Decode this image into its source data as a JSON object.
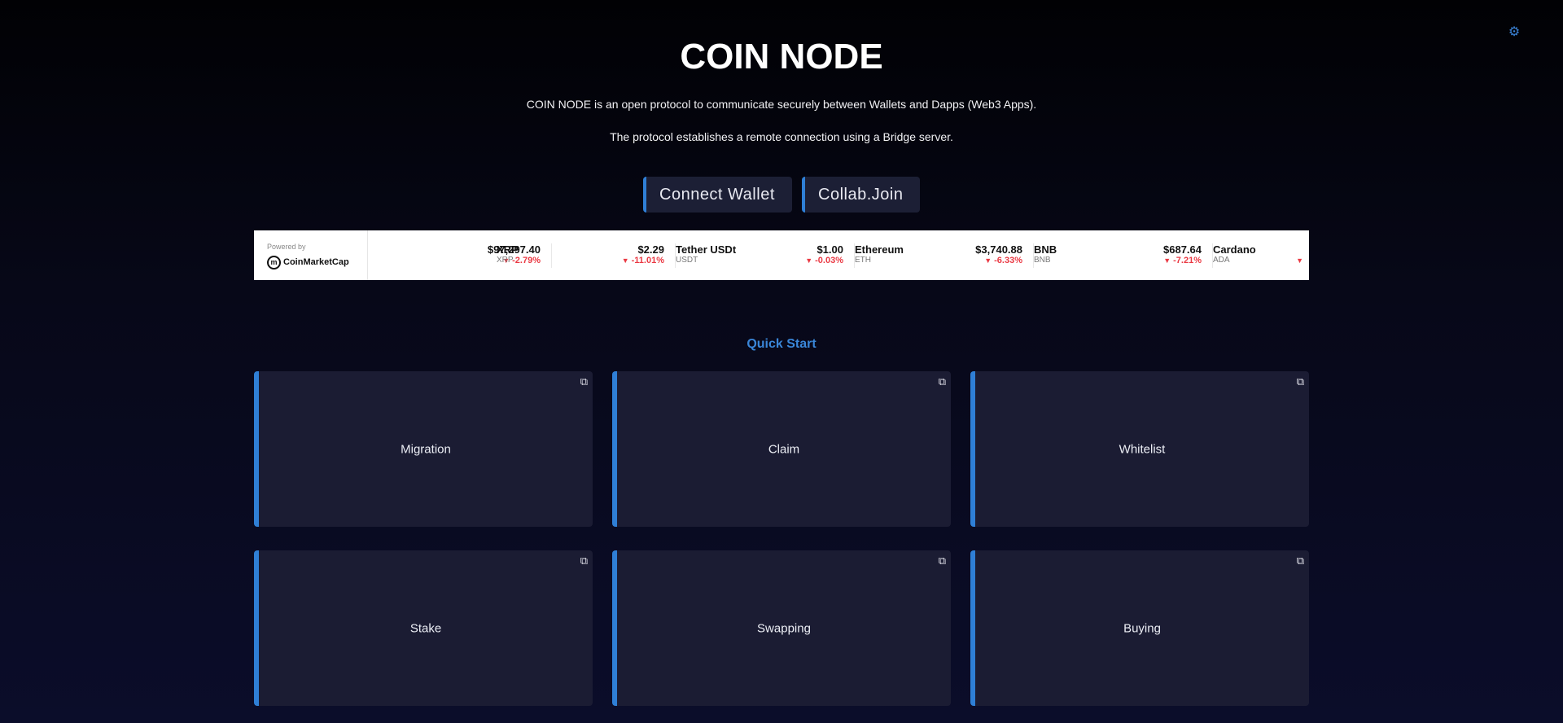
{
  "header": {
    "title": "COIN NODE",
    "description_line1": "COIN NODE is an open protocol to communicate securely between Wallets and Dapps (Web3 Apps).",
    "description_line2": "The protocol establishes a remote connection using a Bridge server.",
    "settings_icon": "gear-icon"
  },
  "actions": {
    "connect_wallet": "Connect Wallet",
    "collab_join": "Collab.Join"
  },
  "ticker": {
    "powered_by": "Powered by",
    "provider": "CoinMarketCap",
    "coins": [
      {
        "name": "",
        "symbol": "",
        "price": "$97,297.40",
        "change": "-2.79%"
      },
      {
        "name": "XRP",
        "symbol": "XRP",
        "price": "$2.29",
        "change": "-11.01%"
      },
      {
        "name": "Tether USDt",
        "symbol": "USDT",
        "price": "$1.00",
        "change": "-0.03%"
      },
      {
        "name": "Ethereum",
        "symbol": "ETH",
        "price": "$3,740.88",
        "change": "-6.33%"
      },
      {
        "name": "BNB",
        "symbol": "BNB",
        "price": "$687.64",
        "change": "-7.21%"
      },
      {
        "name": "Cardano",
        "symbol": "ADA",
        "price": "",
        "change": ""
      }
    ],
    "negative_color": "#ea3943"
  },
  "quick_start": {
    "title": "Quick Start",
    "cards": [
      {
        "label": "Migration"
      },
      {
        "label": "Claim"
      },
      {
        "label": "Whitelist"
      },
      {
        "label": "Stake"
      },
      {
        "label": "Swapping"
      },
      {
        "label": "Buying"
      }
    ],
    "external_icon": "external-link-icon"
  },
  "colors": {
    "accent": "#2f7fd6",
    "card_bg": "#1b1c33",
    "quick_start_title": "#3a86d8"
  }
}
